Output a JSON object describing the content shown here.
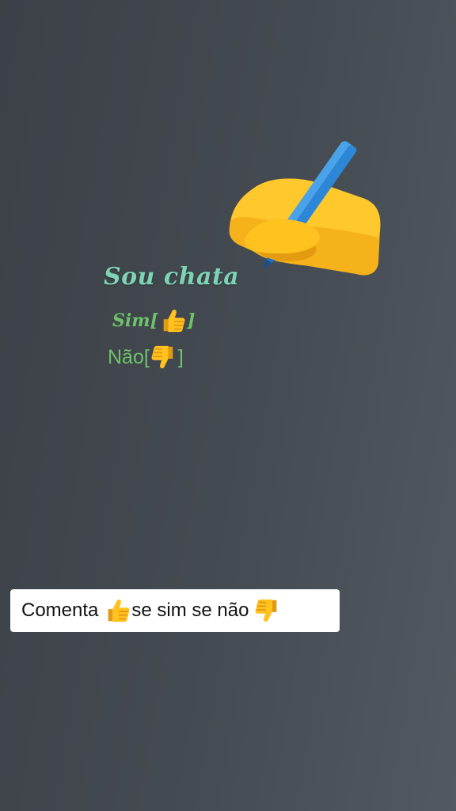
{
  "overlay": {
    "title": "Sou chata",
    "options": [
      {
        "label": "Sim",
        "bracket_open": "[",
        "bracket_close": "]",
        "icon": "thumbs-up-icon"
      },
      {
        "label": "Não",
        "bracket_open": "[",
        "bracket_close": "]",
        "icon": "thumbs-down-icon"
      }
    ],
    "sticker": "writing-hand-icon"
  },
  "caption": {
    "part1": "Comenta",
    "icon1": "thumbs-up-icon",
    "part2": "se sim se não",
    "icon2": "thumbs-down-icon"
  },
  "colors": {
    "title": "#7dd3b4",
    "options": "#6cc36a",
    "background": "#454b52",
    "caption_bg": "#ffffff"
  }
}
